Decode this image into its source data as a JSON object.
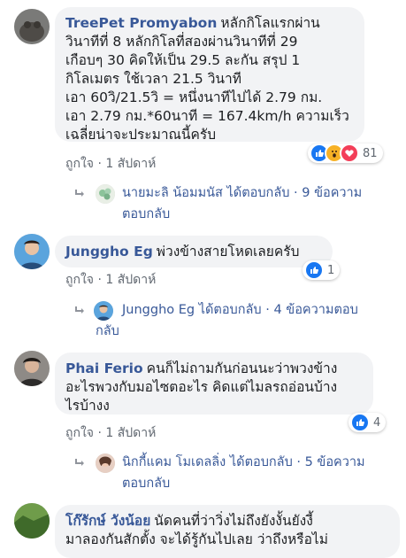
{
  "comments": [
    {
      "author": "TreePet Promyabon",
      "text_lines": [
        "หลักกิโลแรกผ่าน",
        "วินาทีที่ 8 หลักกิโลที่สองผ่านวินาทีที่ 29",
        "เกือบๆ 30 คิดให้เป็น 29.5 ละกัน สรุป 1",
        "กิโลเมตร ใช้เวลา 21.5 วินาที",
        "เอา 60วิ/21.5วิ = หนึ่งนาทีไปได้ 2.79 กม.",
        "เอา 2.79 กม.*60นาที = 167.4km/h ความเร็ว",
        "เฉลี่ยน่าจะประมาณนี้ครับ"
      ],
      "reaction_count": "81",
      "like_label": "ถูกใจ",
      "dot": "·",
      "time": "1 สัปดาห์",
      "reply": {
        "text": "นายมะลิ น้อมมนัส ได้ตอบกลับ · 9 ข้อความ",
        "text2": "ตอบกลับ"
      }
    },
    {
      "author": "Junggho Eg",
      "text_lines": [
        "พ่วงข้างสายโหดเลยครับ"
      ],
      "reaction_count": "1",
      "like_label": "ถูกใจ",
      "dot": "·",
      "time": "1 สัปดาห์",
      "reply": {
        "text": "Junggho Eg ได้ตอบกลับ · 4 ข้อความตอบ",
        "text2": "กลับ"
      }
    },
    {
      "author": "Phai Ferio",
      "text_lines": [
        "คนก็ไม่ถามกันก่อนนะว่าพวงข้าง",
        "อะไรพวงกับมอไซตอะไร คิดแต่ไมลรถอ่อนบ้าง",
        "ไรบ้างง"
      ],
      "reaction_count": "4",
      "like_label": "ถูกใจ",
      "dot": "·",
      "time": "1 สัปดาห์",
      "reply": {
        "text": "นิกกี้แคม โมเดลลิ่ง ได้ตอบกลับ · 5 ข้อความ",
        "text2": "ตอบกลับ"
      }
    },
    {
      "author": "โก๊รักษ์ วังน้อย",
      "text_lines": [
        "นัดคนที่ว่าวิ่งไม่ถึงยังงั้นยังงี้",
        "มาลองกันสักตั้ง จะได้รู้กันไปเลย ว่าถึงหรือไม่"
      ]
    }
  ],
  "colors": {
    "link": "#385898",
    "bubble": "#f2f3f5",
    "meta": "#606770",
    "like": "#1877f2"
  }
}
